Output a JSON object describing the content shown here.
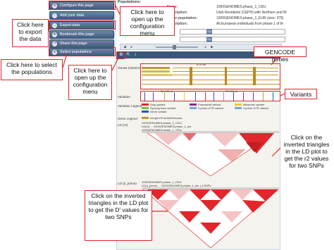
{
  "menu": {
    "items": [
      {
        "label": "Configure this page",
        "icon": "gear-icon"
      },
      {
        "label": "Add your data",
        "icon": "upload-icon"
      },
      {
        "label": "Export data",
        "icon": "export-icon"
      },
      {
        "label": "Bookmark this page",
        "icon": "bookmark-icon"
      },
      {
        "label": "Share this page",
        "icon": "share-icon"
      },
      {
        "label": "Select populations",
        "icon": "people-icon"
      }
    ]
  },
  "populations": {
    "header": "Populations:",
    "rows": [
      {
        "label": "Name:",
        "value": "1000GENOMES:phase_1_CEU"
      },
      {
        "label": "Description:",
        "value": "Utah Residents (CEPH) with Northern and W"
      },
      {
        "label": "Super-population:",
        "value": "1000GENOMES:phase_1_EUR (size: 379)"
      },
      {
        "label": "Description:",
        "value": "All European individuals from phase 1 of th"
      }
    ]
  },
  "panel": {
    "tracks": {
      "genes": "Genes (GENCO...",
      "variation": "Variation",
      "variation_legend": "Variation Legend",
      "gene_legend": "Gene Legend",
      "ld_r2": "LD (r2)",
      "ld_dprime": "LD (d_prime)"
    },
    "ruler": {
      "left": "22,440 kb",
      "right": "22,460 kb",
      "top": "5.03 kb"
    },
    "legend": [
      {
        "label": "Stop gained",
        "color": "#e2262b"
      },
      {
        "label": "Frameshift variant",
        "color": "#8b2a8b"
      },
      {
        "label": "Missense variant",
        "color": "#f0c43a"
      },
      {
        "label": "Synonymous variant",
        "color": "#7ac143"
      },
      {
        "label": "5 prime UTR variant",
        "color": "#7aa6d6"
      },
      {
        "label": "3 prime UTR variant",
        "color": "#7aa6d6"
      },
      {
        "label": "Intron variant",
        "color": "#1c5cae"
      }
    ],
    "gene_legend_item": {
      "label": "merged Ensembl/Havana",
      "color": "#c7962b"
    },
    "ld_r2": {
      "line1": "1000GENOMES:phase_1_CEU",
      "line2": "LD(r2) ... 1000GENOMES:phase_1_eur",
      "line3": "1000GENOMES:phase_1_CEU"
    },
    "ld_dprime": {
      "line1": "1000GENOMES:phase_1_CEU",
      "line2": "LD(d_prime) ... 1000GENOMES:phase_1_eur | 4 SNPs"
    }
  },
  "annotations": {
    "config_top": "Click here to open up the configuration menu",
    "export": "Click here to export the data",
    "populations": "Click here to select the populations",
    "config_panel": "Click here to open up the configuration menu",
    "gencode": "GENCODE genes",
    "variants": "Variants",
    "ld_r2": "Click on the inverted triangles in the LD plot to get the r2 values for two SNPs",
    "ld_dprime": "Click on the inverted triangles in the LD plot to get the D' values for two SNPs"
  },
  "colors": {
    "accent": "#e2262b",
    "menu": "#3f5b80"
  }
}
